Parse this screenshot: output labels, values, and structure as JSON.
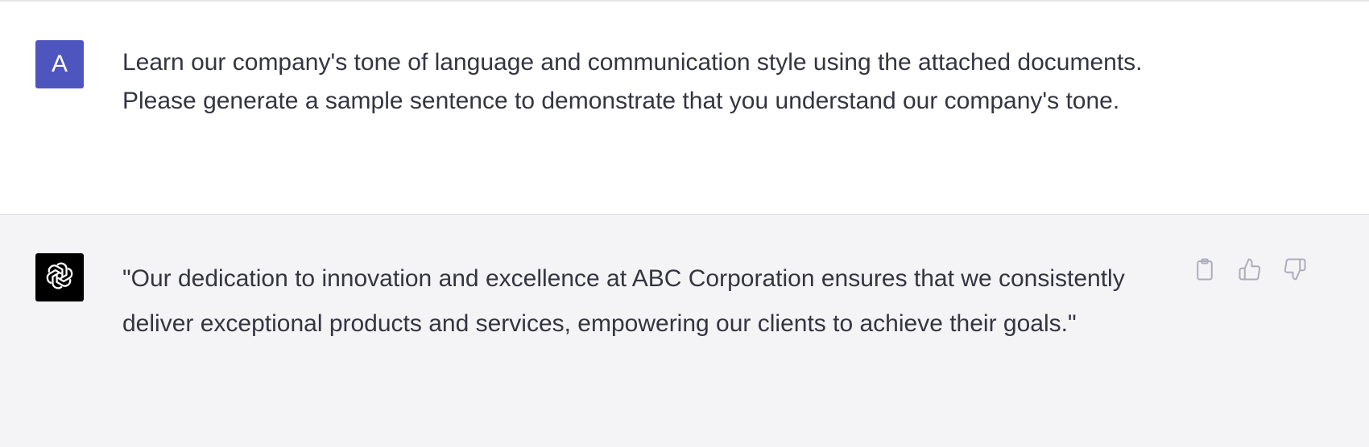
{
  "conversation": {
    "user_message": {
      "avatar_letter": "A",
      "text": "Learn our company's tone of language and communication style using the attached documents. Please generate a sample sentence to demonstrate that you understand our company's tone."
    },
    "assistant_message": {
      "text": "\"Our dedication to innovation and excellence at ABC Corporation ensures that we consistently deliver exceptional products and services, empowering our clients to achieve their goals.\"",
      "actions": [
        {
          "icon": "clipboard-icon"
        },
        {
          "icon": "thumbs-up-icon"
        },
        {
          "icon": "thumbs-down-icon"
        }
      ]
    }
  },
  "colors": {
    "user_avatar_bg": "#4f55be",
    "assistant_avatar_bg": "#000000",
    "assistant_row_bg": "#f4f4f6",
    "text": "#343541",
    "icon": "#acacbe"
  }
}
